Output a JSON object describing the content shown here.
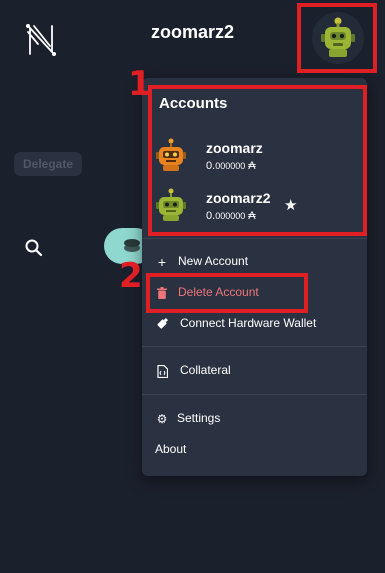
{
  "header": {
    "wallet_name": "zoomarz2"
  },
  "background": {
    "delegate_label": "Delegate"
  },
  "menu": {
    "accounts_title": "Accounts",
    "accounts": [
      {
        "name": "zoomarz",
        "balance_main": "0.",
        "balance_small": "000000",
        "currency": "₳",
        "avatar": "robot-orange-icon",
        "active": false
      },
      {
        "name": "zoomarz2",
        "balance_main": "0.",
        "balance_small": "000000",
        "currency": "₳",
        "avatar": "robot-green-icon",
        "active": true
      }
    ],
    "items": {
      "new_account": "New Account",
      "delete_account": "Delete Account",
      "connect_hw": "Connect Hardware Wallet",
      "collateral": "Collateral",
      "settings": "Settings",
      "about": "About"
    }
  },
  "annotations": {
    "step1": "1",
    "step2": "2",
    "color": "#e01f25"
  },
  "colors": {
    "background": "#1b202d",
    "menu": "#2a3140",
    "danger": "#f0757a",
    "accent": "#8fd8cf"
  }
}
